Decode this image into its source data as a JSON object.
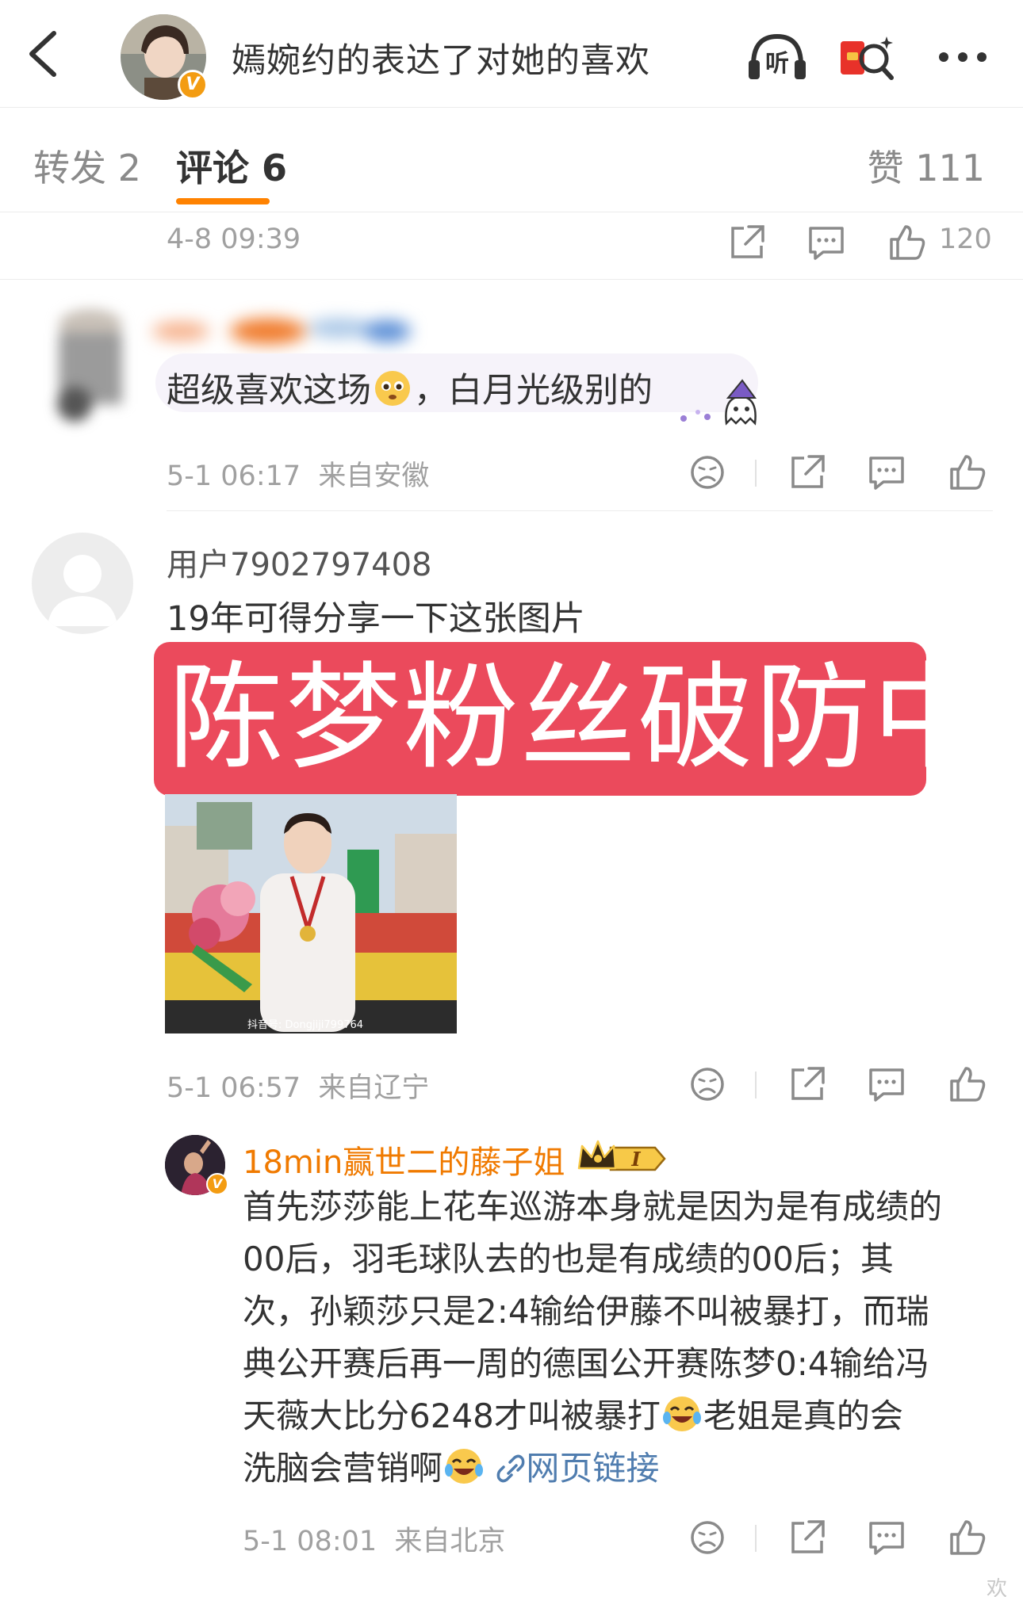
{
  "header": {
    "title": "嫣婉约的表达了对她的喜欢",
    "verified_badge": "V",
    "listen_label": "听"
  },
  "tabs": {
    "repost": "转发 2",
    "comments": "评论 6",
    "likes": "赞 111"
  },
  "post_meta": {
    "time": "4-8 09:39",
    "like_count": "120"
  },
  "comments": [
    {
      "user": "",
      "text_before": "超级喜欢这场",
      "text_after": "，白月光级别的",
      "time": "5-1 06:17",
      "location": "来自安徽"
    },
    {
      "user": "用户7902797408",
      "text": "19年可得分享一下这张图片",
      "banner": "陈梦粉丝破防中",
      "image_watermark": "抖音号: Dongjiji799764",
      "time": "5-1 06:57",
      "location": "来自辽宁"
    }
  ],
  "reply": {
    "user": "18min赢世二的藤子姐",
    "level": "I",
    "verified_badge": "V",
    "line1": "首先莎莎能上花车巡游本身就是因为是有成绩的",
    "line2": "00后，羽毛球队去的也是有成绩的00后；其",
    "line3": "次，孙颖莎只是2:4输给伊藤不叫被暴打，而瑞",
    "line4": "典公开赛后再一周的德国公开赛陈梦0:4输给冯",
    "line5a": "天薇大比分6248才叫被暴打",
    "line5b": "老姐是真的会",
    "line6": "洗脑会营销啊",
    "link": "网页链接",
    "time": "5-1 08:01",
    "location": "来自北京"
  },
  "footer_faint": "欢",
  "colors": {
    "accent": "#ff8200",
    "banner": "#eb4a5c",
    "link": "#507daf",
    "reply_name": "#f07a00"
  }
}
